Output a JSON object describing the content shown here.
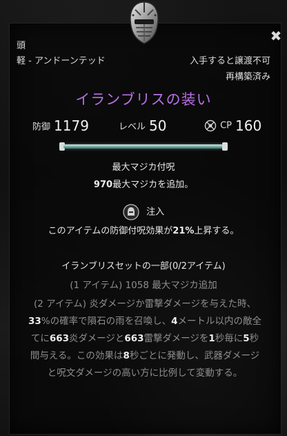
{
  "item": {
    "slot": "頭",
    "weight_type": "軽 - アンドーンテッド",
    "bind_status": "入手すると譲渡不可",
    "retrait_status": "再構築済み",
    "name": "イランブリスの装い",
    "name_color": "#b86fe6"
  },
  "stats": {
    "armor_label": "防御",
    "armor_value": "1179",
    "level_label": "レベル",
    "level_value": "50",
    "cp_label": "CP",
    "cp_value": "160"
  },
  "enchantment": {
    "title": "最大マジカ付呪",
    "value": "970",
    "desc_rest": "最大マジカを追加。"
  },
  "trait": {
    "icon": "infused-trait-icon",
    "name": "注入",
    "desc_pre": "このアイテムの防御付呪効果が",
    "desc_value": "21%",
    "desc_post": "上昇する。"
  },
  "set": {
    "title": "イランブリスセットの一部(0/2アイテム)",
    "bonus1": "(1 アイテム) 1058 最大マジカ追加",
    "bonus2": {
      "t1": "(2 アイテム) 炎ダメージか雷撃ダメージを与えた時、",
      "v1": "33",
      "t2": "%の確率で隕石の雨を召喚し、",
      "v2": "4",
      "t3": "メートル以内の敵全てに",
      "v3": "663",
      "t4": "炎ダメージと",
      "v4": "663",
      "t5": "雷撃ダメージを",
      "v5": "1",
      "t6": "秒毎に",
      "v6": "5",
      "t7": "秒間与える。この効果は",
      "v7": "8",
      "t8": "秒ごとに発動し、武器ダメージと呪文ダメージの高い方に比例して変動する。"
    }
  },
  "icons": {
    "helmet": "helmet-icon",
    "close": "close-icon",
    "cp": "champion-point-icon"
  }
}
